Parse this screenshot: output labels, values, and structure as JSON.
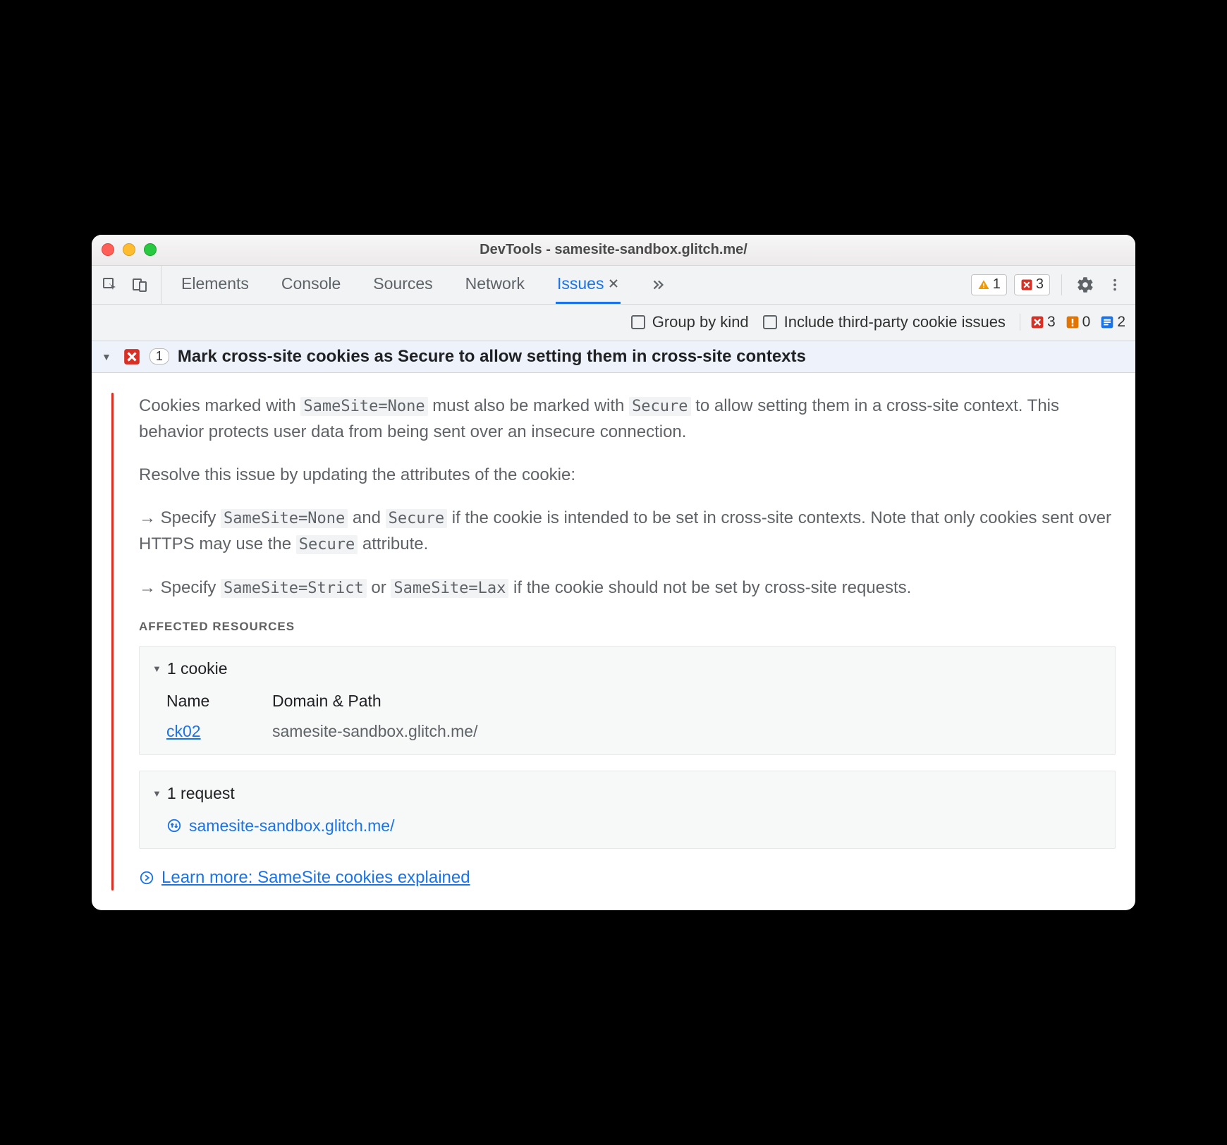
{
  "window": {
    "title": "DevTools - samesite-sandbox.glitch.me/"
  },
  "tabs": {
    "elements": "Elements",
    "console": "Console",
    "sources": "Sources",
    "network": "Network",
    "issues": "Issues"
  },
  "toolbar_badges": {
    "warn_count": "1",
    "error_count": "3"
  },
  "filterbar": {
    "group_by_kind": "Group by kind",
    "include_third_party": "Include third-party cookie issues",
    "counts": {
      "error": "3",
      "warn": "0",
      "info": "2"
    }
  },
  "issue": {
    "count": "1",
    "title": "Mark cross-site cookies as Secure to allow setting them in cross-site contexts",
    "p1_a": "Cookies marked with ",
    "p1_code1": "SameSite=None",
    "p1_b": " must also be marked with ",
    "p1_code2": "Secure",
    "p1_c": " to allow setting them in a cross-site context. This behavior protects user data from being sent over an insecure connection.",
    "p2": "Resolve this issue by updating the attributes of the cookie:",
    "b1_a": "Specify ",
    "b1_code1": "SameSite=None",
    "b1_b": " and ",
    "b1_code2": "Secure",
    "b1_c": " if the cookie is intended to be set in cross-site contexts. Note that only cookies sent over HTTPS may use the ",
    "b1_code3": "Secure",
    "b1_d": " attribute.",
    "b2_a": "Specify ",
    "b2_code1": "SameSite=Strict",
    "b2_b": " or ",
    "b2_code2": "SameSite=Lax",
    "b2_c": " if the cookie should not be set by cross-site requests.",
    "affected_label": "Affected Resources",
    "cookie_section": "1 cookie",
    "cols": {
      "name": "Name",
      "domain": "Domain & Path"
    },
    "cookie": {
      "name": "ck02",
      "domain": "samesite-sandbox.glitch.me/"
    },
    "request_section": "1 request",
    "request": "samesite-sandbox.glitch.me/",
    "learn": "Learn more: SameSite cookies explained"
  }
}
